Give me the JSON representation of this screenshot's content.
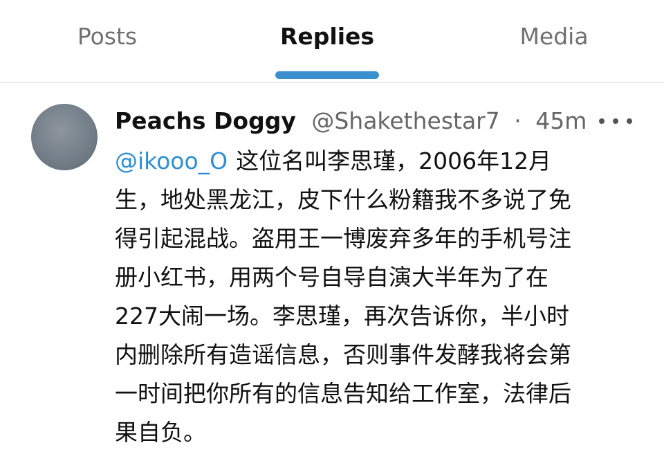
{
  "tabs": {
    "posts": "Posts",
    "replies": "Replies",
    "media": "Media",
    "active": "Replies"
  },
  "post": {
    "author_name": "Peachs Doggy",
    "author_handle": "@Shakethestar7",
    "separator": "·",
    "time": "45m",
    "mention": "@ikooo_O",
    "lines": [
      "这位名叫李思瑾，2006年12月",
      "生，地处黑龙江，皮下什么粉籍我不多说了免",
      "得引起混战。盗用王一博废弃多年的手机号注",
      "册小红书，用两个号自导自演大半年为了在",
      "227大闹一场。李思瑾，再次告诉你，半小时",
      "内删除所有造谣信息，否则事件发酵我将会第",
      "一时间把你所有的信息告知给工作室，法律后",
      "果自负。"
    ],
    "more_icon": "more-horizontal-icon",
    "avatar_color": "#7b858f"
  },
  "colors": {
    "accent": "#3a8fcf",
    "mention": "#2d8fd5",
    "muted_text": "#666666"
  }
}
